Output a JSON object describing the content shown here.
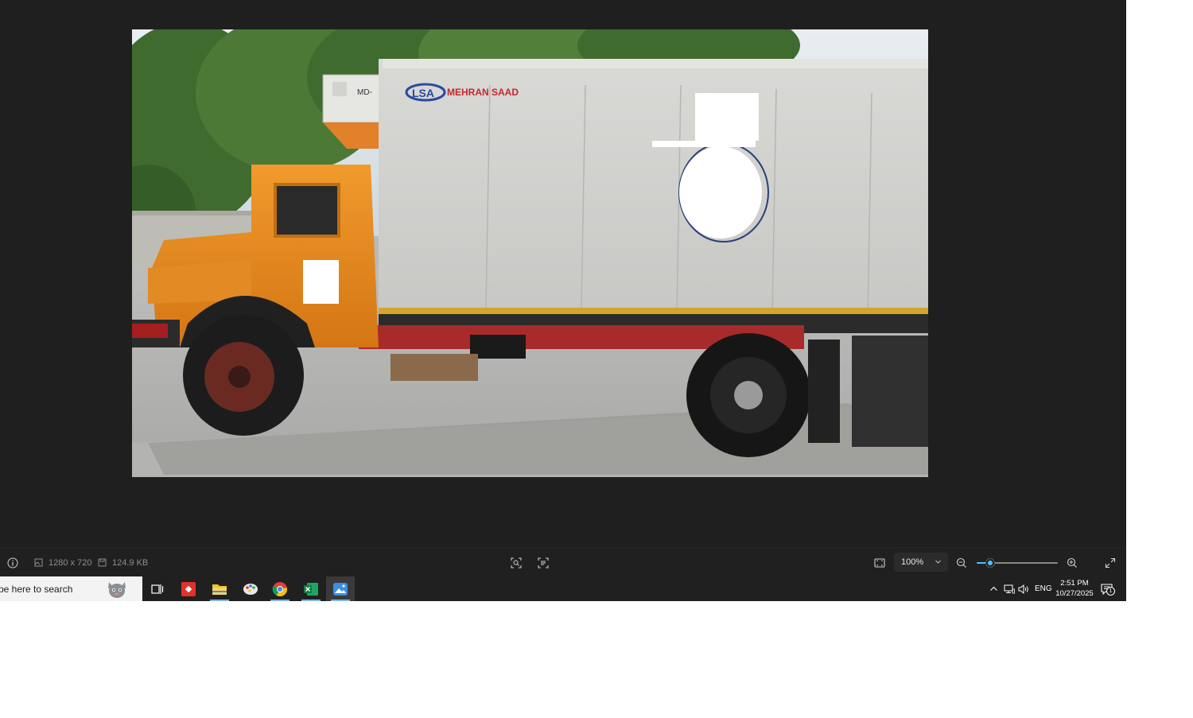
{
  "image": {
    "box_brand_text": "MEHRAN SAAD",
    "reefer_unit_label": "MD-"
  },
  "status_bar": {
    "dimensions": "1280 x 720",
    "file_size": "124.9 KB",
    "zoom_value": "100%",
    "zoom_level": 0.17
  },
  "taskbar": {
    "search_placeholder": "pe here to search",
    "language": "ENG",
    "time": "2:51 PM",
    "date": "10/27/2025",
    "notification_count": "1"
  },
  "colors": {
    "accent": "#4cc2ff",
    "app_background": "#1f1f1f",
    "taskbar_background": "#202020",
    "truck_cab": "#e58a1e"
  },
  "icons": {
    "info": "info-icon",
    "dimensions": "image-size-icon",
    "file_size": "file-save-icon",
    "visual_search": "visual-search-icon",
    "ocr": "text-scan-icon",
    "fit_to_window": "fit-to-window-icon",
    "zoom_out": "zoom-out-icon",
    "zoom_in": "zoom-in-icon",
    "fullscreen": "fullscreen-icon",
    "task_view": "task-view-icon",
    "show_hidden": "chevron-up-icon",
    "network": "network-icon",
    "volume": "volume-icon",
    "notifications": "notification-icon"
  }
}
